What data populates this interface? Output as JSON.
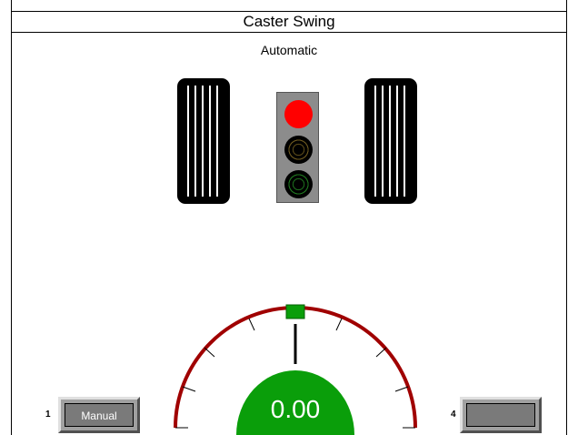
{
  "header": {
    "title": "Caster Swing",
    "mode": "Automatic"
  },
  "traffic_light": {
    "active": "red",
    "colors": {
      "red": "#ff0000",
      "amber": "#5a4a18",
      "green": "#1f7a1f"
    }
  },
  "gauge": {
    "value": "0.00",
    "fill_color": "#0a9e0a",
    "arc_color": "#a00000",
    "pointer_color": "#0a9e0a"
  },
  "buttons": {
    "left": {
      "index": "1",
      "label": "Manual"
    },
    "right": {
      "index": "4",
      "label": ""
    }
  }
}
